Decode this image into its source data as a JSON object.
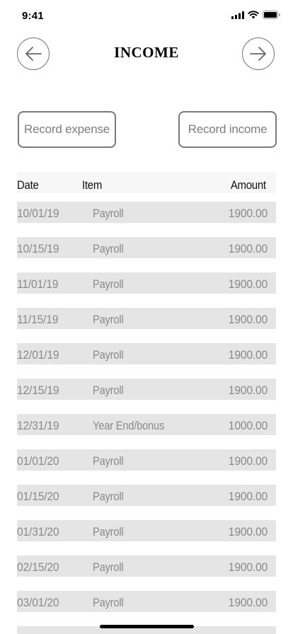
{
  "status_bar": {
    "time": "9:41",
    "icons": [
      "signal-icon",
      "wifi-icon",
      "battery-icon"
    ]
  },
  "header": {
    "title": "INCOME",
    "back_icon": "arrow-left-icon",
    "forward_icon": "arrow-right-icon"
  },
  "actions": {
    "record_expense": "Record expense",
    "record_income": "Record income"
  },
  "table": {
    "columns": [
      "Date",
      "Item",
      "Amount"
    ],
    "rows": [
      {
        "date": "10/01/19",
        "item": "Payroll",
        "amount": "1900.00"
      },
      {
        "date": "10/15/19",
        "item": "Payroll",
        "amount": "1900.00"
      },
      {
        "date": "11/01/19",
        "item": "Payroll",
        "amount": "1900.00"
      },
      {
        "date": "11/15/19",
        "item": "Payroll",
        "amount": "1900.00"
      },
      {
        "date": "12/01/19",
        "item": "Payroll",
        "amount": "1900.00"
      },
      {
        "date": "12/15/19",
        "item": "Payroll",
        "amount": "1900.00"
      },
      {
        "date": "12/31/19",
        "item": "Year End/bonus",
        "amount": "1000.00"
      },
      {
        "date": "01/01/20",
        "item": "Payroll",
        "amount": "1900.00"
      },
      {
        "date": "01/15/20",
        "item": "Payroll",
        "amount": "1900.00"
      },
      {
        "date": "01/31/20",
        "item": "Payroll",
        "amount": "1900.00"
      },
      {
        "date": "02/15/20",
        "item": "Payroll",
        "amount": "1900.00"
      },
      {
        "date": "03/01/20",
        "item": "Payroll",
        "amount": "1900.00"
      }
    ]
  },
  "colors": {
    "row_background": "#e5e5e5",
    "header_background": "#f7f7f7",
    "muted_text": "#8a8a8a",
    "button_border": "#7a7a7a"
  }
}
